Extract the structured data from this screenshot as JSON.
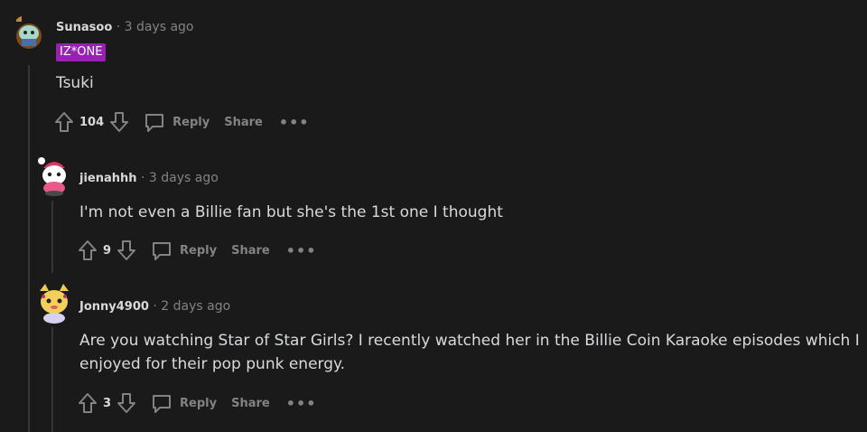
{
  "comments": [
    {
      "username": "Sunasoo",
      "separator": "·",
      "time": "3 days ago",
      "flair": "IZ*ONE",
      "text": "Tsuki",
      "votes": "104",
      "reply_label": "Reply",
      "share_label": "Share",
      "more_label": "•••",
      "flair_color": "#9a1fb5"
    },
    {
      "username": "jienahhh",
      "separator": "·",
      "time": "3 days ago",
      "text": "I'm not even a Billie fan but she's the 1st one I thought",
      "votes": "9",
      "reply_label": "Reply",
      "share_label": "Share",
      "more_label": "•••"
    },
    {
      "username": "Jonny4900",
      "separator": "·",
      "time": "2 days ago",
      "text_line1": "Are you watching Star of Star Girls? I recently watched her in the Billie Coin Karaoke episodes which I",
      "text_line2": "enjoyed for their pop punk energy.",
      "votes": "3",
      "reply_label": "Reply",
      "share_label": "Share",
      "more_label": "•••"
    }
  ],
  "colors": {
    "background": "#1a1a1b",
    "text": "#d7dadc",
    "muted": "#818384",
    "thread_line": "#343536"
  }
}
